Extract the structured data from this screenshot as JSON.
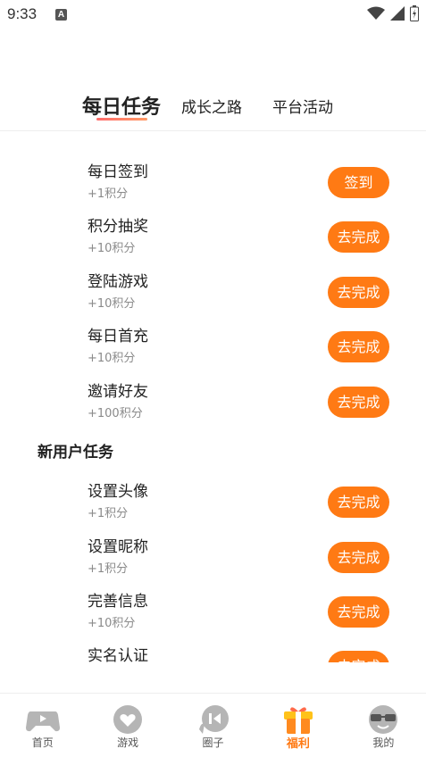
{
  "status_bar": {
    "time": "9:33",
    "indicator": "A"
  },
  "tabs": [
    {
      "label": "每日任务",
      "active": true
    },
    {
      "label": "成长之路",
      "active": false
    },
    {
      "label": "平台活动",
      "active": false
    }
  ],
  "daily_tasks": [
    {
      "title": "每日签到",
      "points": "+1积分",
      "button": "签到"
    },
    {
      "title": "积分抽奖",
      "points": "+10积分",
      "button": "去完成"
    },
    {
      "title": "登陆游戏",
      "points": "+10积分",
      "button": "去完成"
    },
    {
      "title": "每日首充",
      "points": "+10积分",
      "button": "去完成"
    },
    {
      "title": "邀请好友",
      "points": "+100积分",
      "button": "去完成"
    }
  ],
  "new_user_section": {
    "title": "新用户任务",
    "tasks": [
      {
        "title": "设置头像",
        "points": "+1积分",
        "button": "去完成"
      },
      {
        "title": "设置昵称",
        "points": "+1积分",
        "button": "去完成"
      },
      {
        "title": "完善信息",
        "points": "+10积分",
        "button": "去完成"
      },
      {
        "title": "实名认证",
        "points": "",
        "button": "去完成"
      }
    ]
  },
  "bottom_nav": [
    {
      "label": "首页",
      "icon": "gamepad-icon",
      "active": false
    },
    {
      "label": "游戏",
      "icon": "heart-bubble-icon",
      "active": false
    },
    {
      "label": "圈子",
      "icon": "play-bubble-icon",
      "active": false
    },
    {
      "label": "福利",
      "icon": "gift-icon",
      "active": true
    },
    {
      "label": "我的",
      "icon": "sunglasses-face-icon",
      "active": false
    }
  ],
  "colors": {
    "accent": "#ff7a14",
    "tab_underline": "#ff6c6c",
    "muted_text": "#8a8a8a"
  }
}
